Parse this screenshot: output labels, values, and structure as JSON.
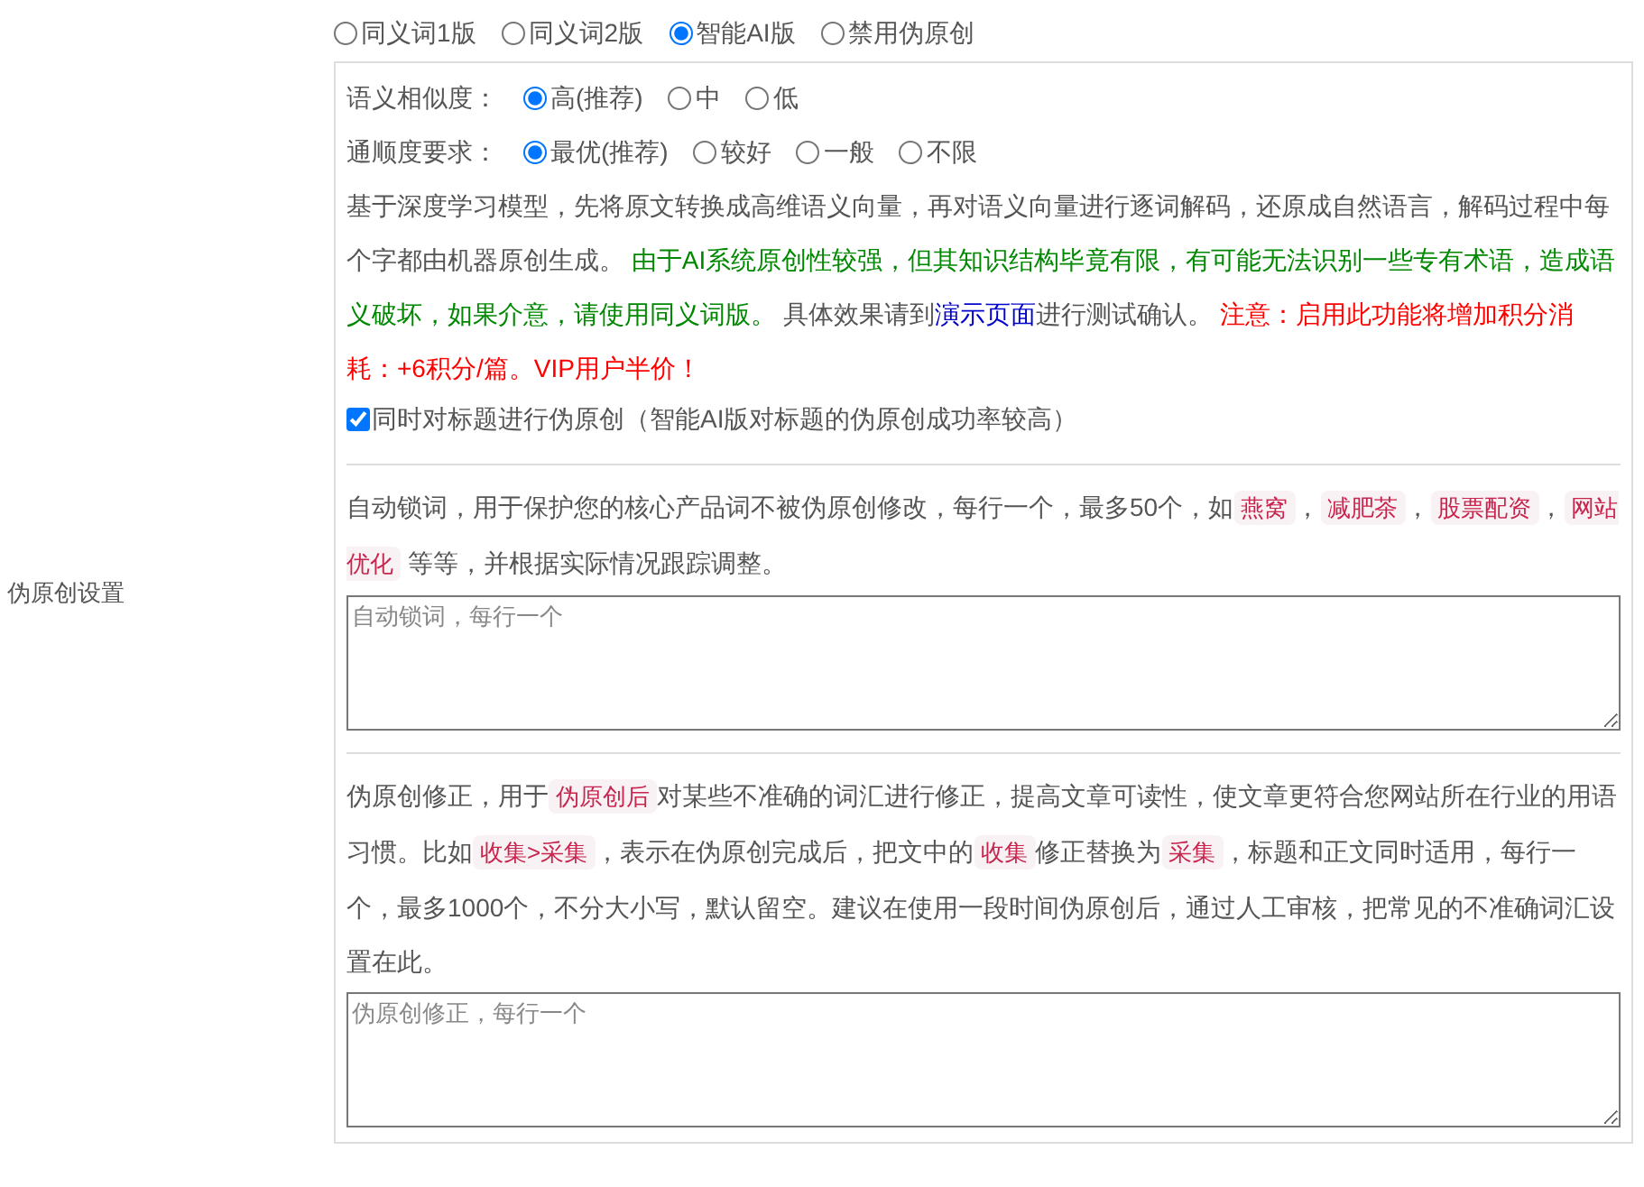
{
  "section_label": "伪原创设置",
  "modes": [
    {
      "label": "同义词1版",
      "selected": false
    },
    {
      "label": "同义词2版",
      "selected": false
    },
    {
      "label": "智能AI版",
      "selected": true
    },
    {
      "label": "禁用伪原创",
      "selected": false
    }
  ],
  "ai_settings": {
    "groups": [
      {
        "label": "语义相似度：",
        "options": [
          {
            "label": "高(推荐)",
            "selected": true
          },
          {
            "label": "中",
            "selected": false
          },
          {
            "label": "低",
            "selected": false
          }
        ]
      },
      {
        "label": "通顺度要求：",
        "options": [
          {
            "label": "最优(推荐)",
            "selected": true
          },
          {
            "label": "较好",
            "selected": false
          },
          {
            "label": "一般",
            "selected": false
          },
          {
            "label": "不限",
            "selected": false
          }
        ]
      }
    ],
    "description": [
      {
        "kind": "plain",
        "text": "基于深度学习模型，先将原文转换成高维语义向量，再对语义向量进行逐词解码，还原成自然语言，解码过程中每个字都由机器原创生成。 "
      },
      {
        "kind": "green",
        "text": "由于AI系统原创性较强，但其知识结构毕竟有限，有可能无法识别一些专有术语，造成语义破坏，如果介意，请使用同义词版。"
      },
      {
        "kind": "plain",
        "text": " 具体效果请到"
      },
      {
        "kind": "link",
        "text": "演示页面"
      },
      {
        "kind": "plain",
        "text": "进行测试确认。 "
      },
      {
        "kind": "red",
        "text": "注意：启用此功能将增加积分消耗：+6积分/篇。VIP用户半价！"
      }
    ],
    "title_option": {
      "label": "同时对标题进行伪原创（智能AI版对标题的伪原创成功率较高）",
      "checked": true
    }
  },
  "lock_words": {
    "description": [
      {
        "kind": "plain",
        "text": "自动锁词，用于保护您的核心产品词不被伪原创修改，每行一个，最多50个，如"
      },
      {
        "kind": "code",
        "text": "燕窝"
      },
      {
        "kind": "plain",
        "text": "，"
      },
      {
        "kind": "code",
        "text": "减肥茶"
      },
      {
        "kind": "plain",
        "text": "，"
      },
      {
        "kind": "code",
        "text": "股票配资"
      },
      {
        "kind": "plain",
        "text": "，"
      },
      {
        "kind": "code",
        "text": "网站优化"
      },
      {
        "kind": "plain",
        "text": " 等等，并根据实际情况跟踪调整。"
      }
    ],
    "placeholder": "自动锁词，每行一个"
  },
  "corrections": {
    "description": [
      {
        "kind": "plain",
        "text": "伪原创修正，用于"
      },
      {
        "kind": "code",
        "text": "伪原创后"
      },
      {
        "kind": "plain",
        "text": "对某些不准确的词汇进行修正，提高文章可读性，使文章更符合您网站所在行业的用语习惯。比如"
      },
      {
        "kind": "code",
        "text": "收集>采集"
      },
      {
        "kind": "plain",
        "text": "，表示在伪原创完成后，把文中的"
      },
      {
        "kind": "code",
        "text": "收集"
      },
      {
        "kind": "plain",
        "text": "修正替换为"
      },
      {
        "kind": "code",
        "text": "采集"
      },
      {
        "kind": "plain",
        "text": "，标题和正文同时适用，每行一个，最多1000个，不分大小写，默认留空。建议在使用一段时间伪原创后，通过人工审核，把常见的不准确词汇设置在此。"
      }
    ],
    "placeholder": "伪原创修正，每行一个"
  }
}
